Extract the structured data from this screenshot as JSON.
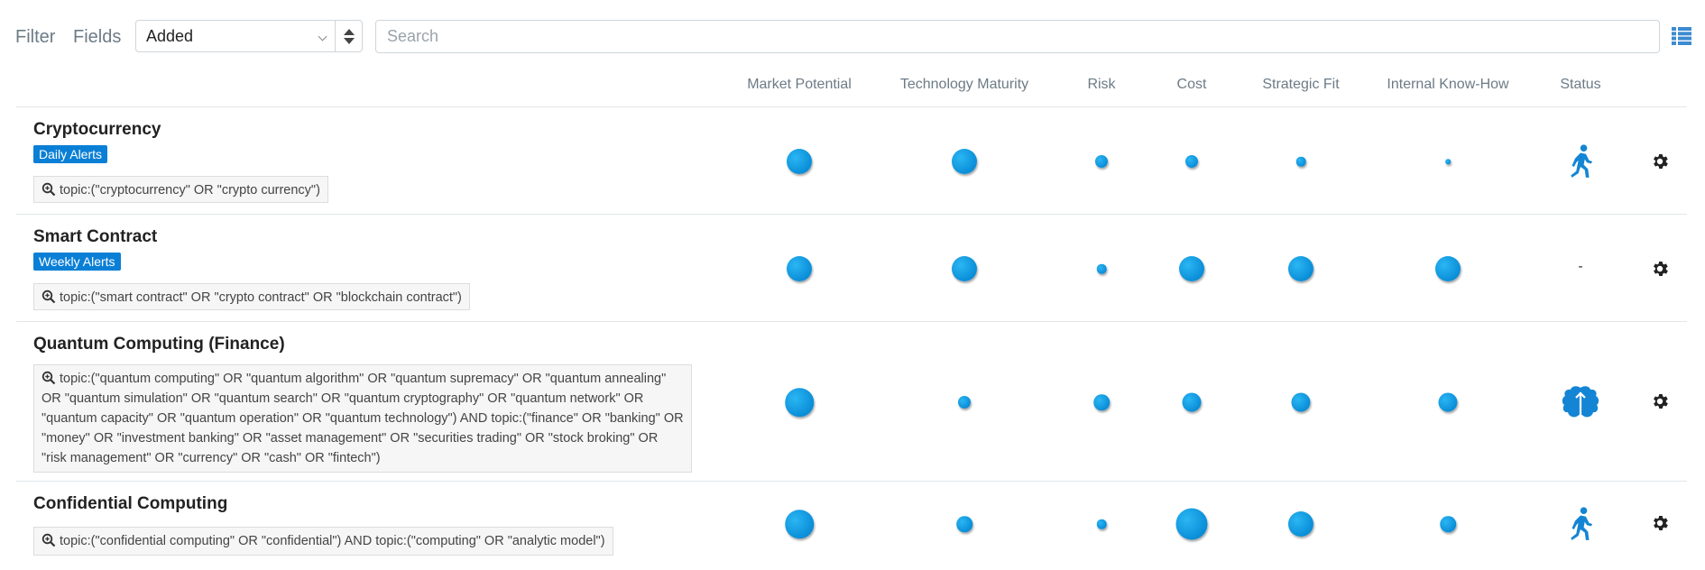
{
  "toolbar": {
    "filter_label": "Filter",
    "fields_label": "Fields",
    "sort_value": "Added",
    "search_placeholder": "Search"
  },
  "columns": [
    "Market Potential",
    "Technology Maturity",
    "Risk",
    "Cost",
    "Strategic Fit",
    "Internal Know-How",
    "Status"
  ],
  "colors": {
    "accent": "#0a7fd6",
    "bubble": "#1aa3e8",
    "muted_text": "#6d7b86"
  },
  "rows": [
    {
      "title": "Cryptocurrency",
      "badge": "Daily Alerts",
      "query": "topic:(\"cryptocurrency\" OR \"crypto currency\")",
      "scores": [
        4,
        4,
        2,
        2,
        1.5,
        0.8
      ],
      "status": "walking-person-icon"
    },
    {
      "title": "Smart Contract",
      "badge": "Weekly Alerts",
      "query": "topic:(\"smart contract\" OR \"crypto contract\" OR \"blockchain contract\")",
      "scores": [
        4,
        4,
        1.5,
        4,
        4,
        4
      ],
      "status": "-"
    },
    {
      "title": "Quantum Computing (Finance)",
      "badge": "",
      "query": "topic:(\"quantum computing\" OR \"quantum algorithm\" OR \"quantum supremacy\" OR \"quantum annealing\" OR \"quantum simulation\" OR \"quantum search\" OR \"quantum cryptography\" OR \"quantum network\" OR \"quantum capacity\" OR \"quantum operation\" OR \"quantum technology\") AND topic:(\"finance\" OR \"banking\" OR \"money\" OR \"investment banking\" OR \"asset management\" OR \"securities trading\" OR \"stock broking\" OR \"risk management\" OR \"currency\" OR \"cash\" OR \"fintech\")",
      "scores": [
        4.5,
        2,
        2.5,
        3,
        3,
        3
      ],
      "status": "brain-icon"
    },
    {
      "title": "Confidential Computing",
      "badge": "",
      "query": "topic:(\"confidential computing\" OR \"confidential\") AND topic:(\"computing\" OR \"analytic model\")",
      "scores": [
        4.5,
        2.5,
        1.5,
        5,
        4,
        2.5
      ],
      "status": "walking-person-icon"
    }
  ]
}
